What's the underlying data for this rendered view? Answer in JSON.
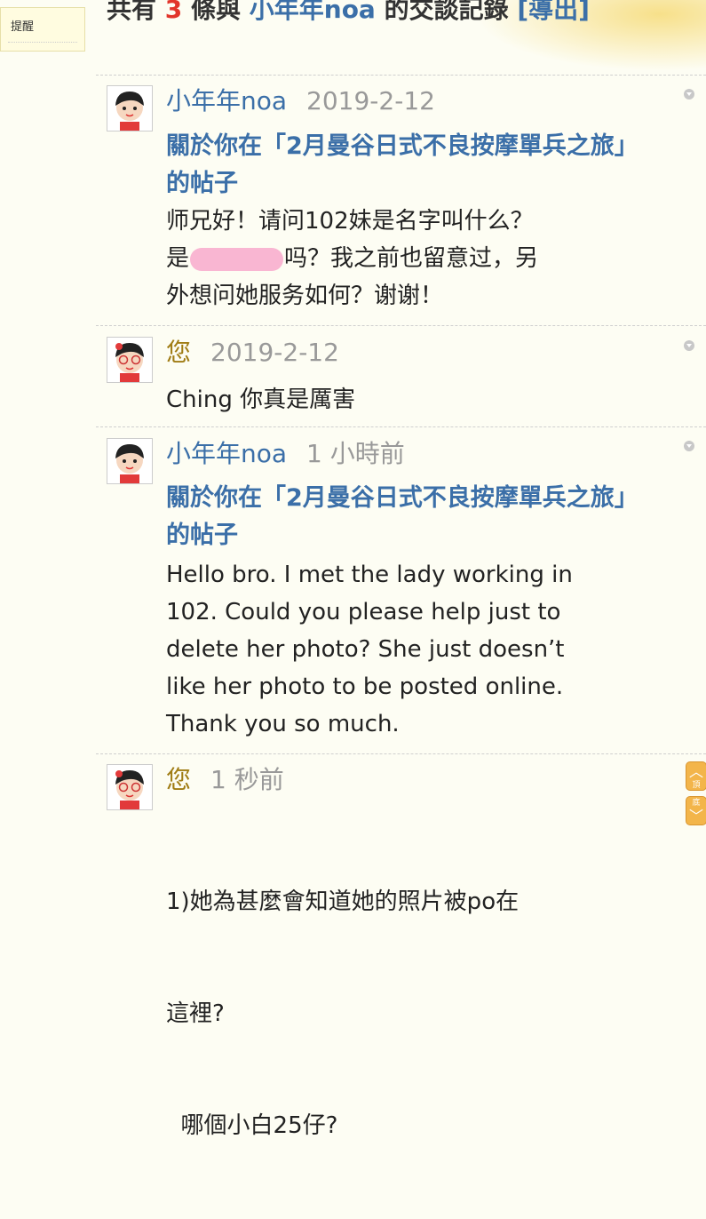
{
  "remind": {
    "label": "提醒"
  },
  "header": {
    "prefix": "共有",
    "count": "3",
    "mid": "條與",
    "name": "小年年noa",
    "suffix": "的交談記錄",
    "export_label": "[導出]"
  },
  "messages": [
    {
      "author": "小年年noa",
      "time": "2019-2-12",
      "topic": "關於你在「2月曼谷日式不良按摩單兵之旅」的帖子",
      "body_lines": [
        "师兄好！请问102妹是名字叫什么？",
        "吗？我之前也留意过，另",
        "外想问她服务如何？谢谢！"
      ],
      "body_prefix": "是"
    },
    {
      "author": "您",
      "time": "2019-2-12",
      "body": "Ching 你真是厲害"
    },
    {
      "author": "小年年noa",
      "time": "1 小時前",
      "topic": "關於你在「2月曼谷日式不良按摩單兵之旅」的帖子",
      "body": "Hello bro. I met the lady working in 102. Could you please help just to delete her photo? She just doesn’t like her photo to be posted online. Thank you so much."
    },
    {
      "author": "您",
      "time": "1 秒前",
      "body_lines": [
        "1)她為甚麼會知道她的照片被po在",
        "這裡?",
        "  哪個小白25仔?"
      ]
    }
  ],
  "scroll": {
    "up_icon": "chevron-up-icon",
    "down_icon": "chevron-down-icon",
    "up_label": "頂",
    "down_label": "底"
  }
}
